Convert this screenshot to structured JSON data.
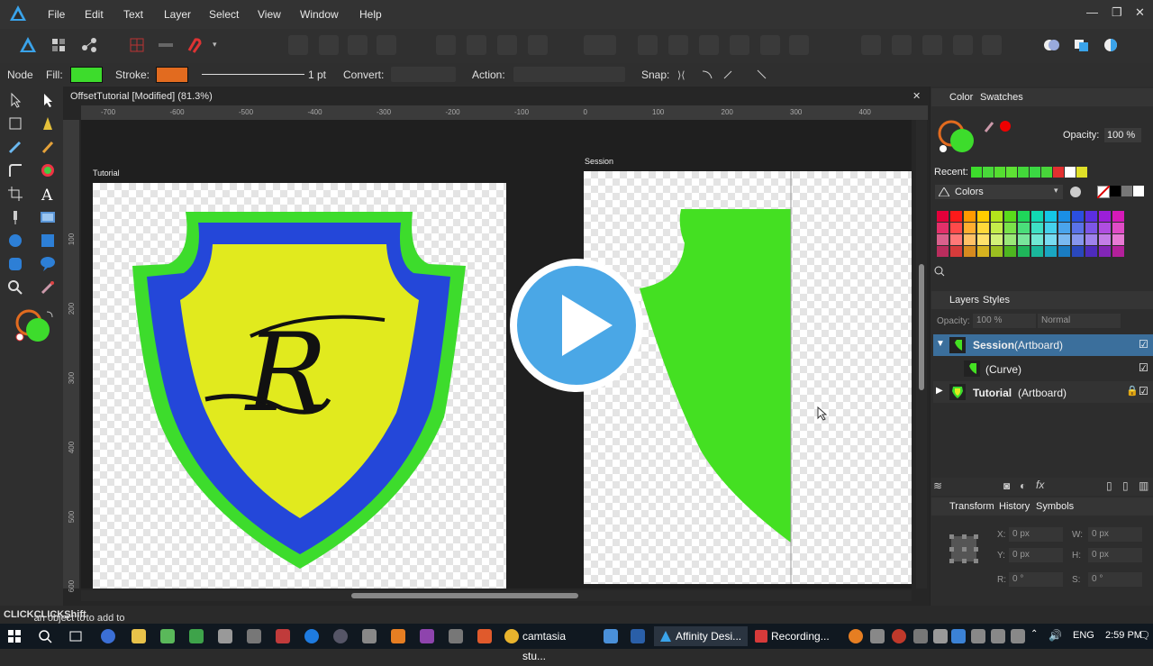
{
  "menu": [
    "File",
    "Edit",
    "Text",
    "Layer",
    "Select",
    "View",
    "Window",
    "Help"
  ],
  "window_controls": {
    "min": "—",
    "restore": "❐",
    "close": "✕"
  },
  "context_bar": {
    "mode": "Node",
    "fill_label": "Fill:",
    "fill_color": "#3ddc2c",
    "stroke_label": "Stroke:",
    "stroke_color": "#e26b1f",
    "stroke_width": "1 pt",
    "convert_label": "Convert:",
    "action_label": "Action:",
    "snap_label": "Snap:"
  },
  "document": {
    "title": "OffsetTutorial [Modified] (81.3%)",
    "close": "✕",
    "ruler_h": [
      "-700",
      "-600",
      "-500",
      "-400",
      "-300",
      "-200",
      "-100",
      "0",
      "100",
      "200",
      "300",
      "400"
    ],
    "ruler_v": [
      "100",
      "200",
      "300",
      "400",
      "500",
      "600"
    ],
    "artboards": {
      "left": "Tutorial",
      "right": "Session"
    },
    "monogram": "R"
  },
  "color_panel": {
    "tabs": [
      "Color",
      "Swatches"
    ],
    "opacity_label": "Opacity:",
    "opacity_value": "100 %",
    "recent_label": "Recent:",
    "recent_colors": [
      "#3ddc2c",
      "#49d93a",
      "#55de30",
      "#5ee234",
      "#43d83a",
      "#3bd743",
      "#48d63a",
      "#e23030",
      "#ffffff",
      "#e0e028"
    ],
    "palette_name": "Colors",
    "palette_rows": [
      [
        "#e3003a",
        "#ff1a1a",
        "#ff9a00",
        "#ffcc00",
        "#b4e51c",
        "#5adb1b",
        "#1fd65a",
        "#11d8b3",
        "#14c7e6",
        "#1a8fe6",
        "#2b4fe0",
        "#5b2ee0",
        "#9b1fd9",
        "#d61ab8"
      ],
      [
        "#e3306a",
        "#ff4a4a",
        "#ffae30",
        "#ffd93a",
        "#c4ec4a",
        "#7ae24a",
        "#4ade7a",
        "#3ee0c4",
        "#45d1ec",
        "#4aa4ec",
        "#5a72e8",
        "#7d56e6",
        "#b04ee0",
        "#e04cc6"
      ],
      [
        "#d9608c",
        "#ff7878",
        "#ffc166",
        "#ffe16b",
        "#d2f178",
        "#9ae878",
        "#78e69b",
        "#70e8d4",
        "#77dcf1",
        "#7ab9f1",
        "#8696ee",
        "#9f82ec",
        "#c37de7",
        "#e87ad4"
      ],
      [
        "#b92d5d",
        "#d63b3b",
        "#d68a1f",
        "#d6b21f",
        "#9bbf20",
        "#4eb620",
        "#1fb55a",
        "#1ab79b",
        "#1aa6c2",
        "#1a7cc2",
        "#2a48bd",
        "#4e2bbd",
        "#8226b7",
        "#b3209b"
      ]
    ]
  },
  "layers_panel": {
    "tabs": [
      "Layers",
      "Styles"
    ],
    "opacity_label": "Opacity:",
    "opacity_value": "100 %",
    "blend": "Normal",
    "rows": [
      {
        "name": "Session",
        "kind": "(Artboard)"
      },
      {
        "name": "",
        "kind": "(Curve)"
      },
      {
        "name": "Tutorial",
        "kind": "(Artboard)"
      }
    ]
  },
  "transform_panel": {
    "tabs": [
      "Transform",
      "History",
      "Symbols"
    ],
    "x_label": "X:",
    "x_value": "0 px",
    "y_label": "Y:",
    "y_value": "0 px",
    "w_label": "W:",
    "w_value": "0 px",
    "h_label": "H:",
    "h_value": "0 px",
    "r_label": "R:",
    "r_value": "0 °",
    "s_label": "S:",
    "s_value": "0 °"
  },
  "status": {
    "click1": "CLICK",
    "text1": " an object to select it. ",
    "click2": "CLICK",
    "plus": "+",
    "shift": "Shift",
    "text2": " to add to selection."
  },
  "taskbar": {
    "items": [
      "camtasia stu...",
      "Affinity Desi...",
      "Recording..."
    ],
    "lang": "ENG",
    "time": "2:59 PM"
  },
  "colors": {
    "accent": "#4aa7e6",
    "blue_shield": "#2447d9",
    "yellow": "#e1ea1e",
    "green": "#3ddc2c"
  }
}
